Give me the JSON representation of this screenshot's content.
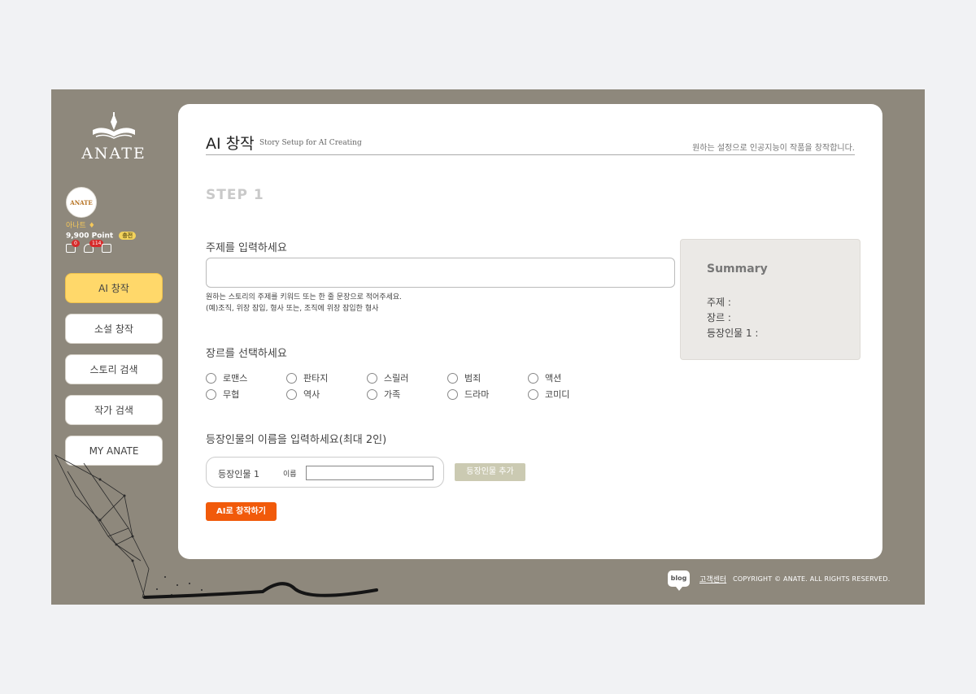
{
  "brand": {
    "logo_text": "ANATE",
    "avatar_text": "ANATE"
  },
  "user": {
    "name": "아나트",
    "points": "9,900 Point",
    "charge_label": "충전",
    "message_count": "0",
    "notification_count": "114"
  },
  "sidebar": {
    "items": [
      {
        "label": "AI 창작",
        "active": true
      },
      {
        "label": "소설 창작",
        "active": false
      },
      {
        "label": "스토리 검색",
        "active": false
      },
      {
        "label": "작가 검색",
        "active": false
      },
      {
        "label": "MY ANATE",
        "active": false
      }
    ]
  },
  "header": {
    "title": "AI 창작",
    "subtitle": "Story Setup for AI Creating",
    "description": "원하는 설정으로 인공지능이 작품을 창작합니다."
  },
  "form": {
    "step": "STEP 1",
    "topic_label": "주제를 입력하세요",
    "topic_value": "",
    "topic_hint1": "원하는 스토리의 주제를 키워드 또는 한 줄 문장으로 적어주세요.",
    "topic_hint2": "(예)조직, 위장 잠입, 형사 또는, 조직에 위장 잠입한 형사",
    "genre_label": "장르를 선택하세요",
    "genres_row1": [
      "로맨스",
      "판타지",
      "스릴러",
      "범죄",
      "액션"
    ],
    "genres_row2": [
      "무협",
      "역사",
      "가족",
      "드라마",
      "코미디"
    ],
    "character_label": "등장인물의 이름을 입력하세요(최대 2인)",
    "character_item_label": "등장인물 1",
    "name_label": "이름",
    "name_value": "",
    "add_character_label": "등장인물 추가",
    "submit_label": "AI로 창작하기"
  },
  "summary": {
    "title": "Summary",
    "topic_line": "주제 :",
    "genre_line": "장르 :",
    "character_line": "등장인물 1 :"
  },
  "footer": {
    "blog_label": "blog",
    "support_link": "고객센터",
    "copyright": "COPYRIGHT © ANATE. ALL RIGHTS RESERVED."
  },
  "colors": {
    "frame_bg": "#8e887c",
    "active_nav": "#ffd86a",
    "submit_button": "#f15a0a",
    "add_button": "#cbcab2"
  }
}
